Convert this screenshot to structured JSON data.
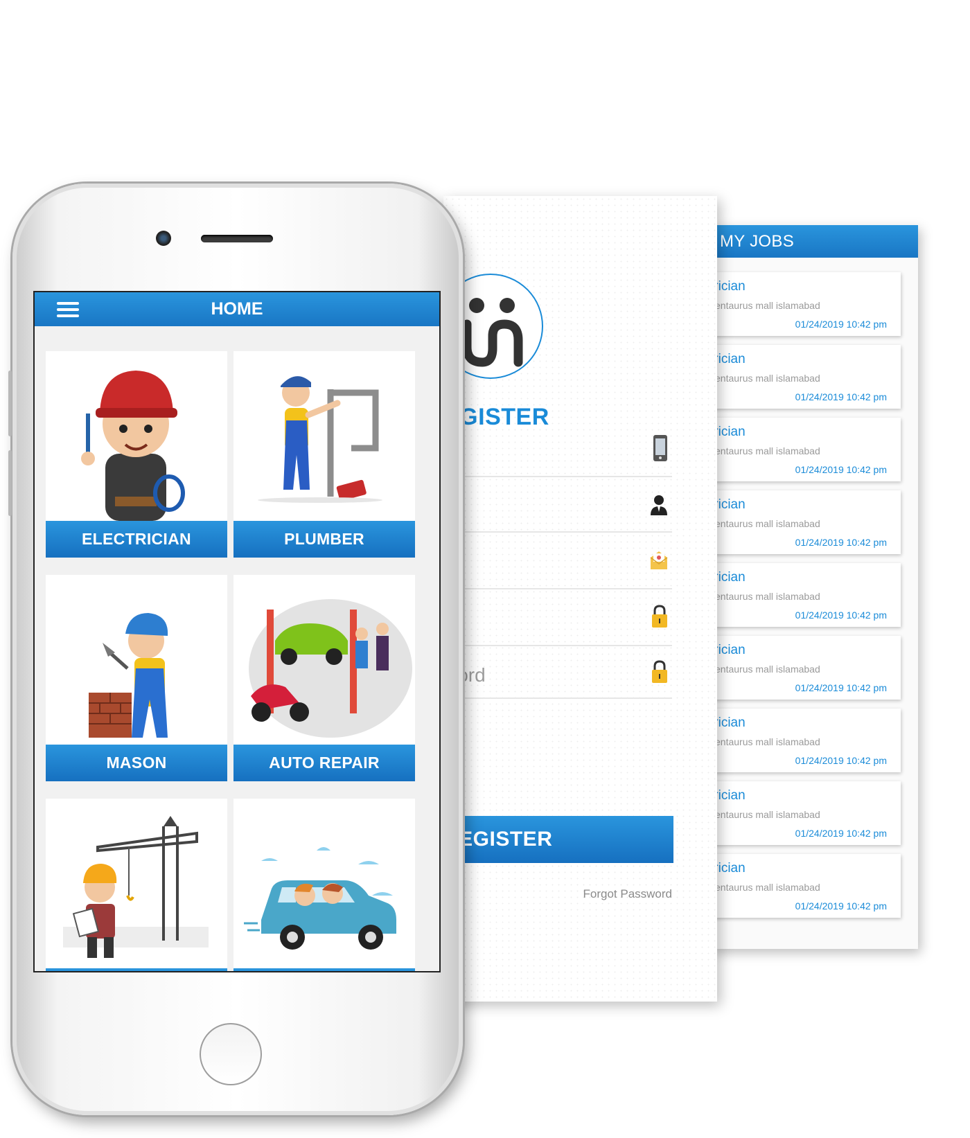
{
  "colors": {
    "accent": "#1a8bd8",
    "accent_dark": "#1670c0",
    "background": "#ffffff",
    "muted_text": "#9d9d9d"
  },
  "jobs_screen": {
    "header": "MY JOBS",
    "jobs": [
      {
        "title": "trician",
        "location": "centaurus mall islamabad",
        "datetime": "01/24/2019  10:42 pm"
      },
      {
        "title": "trician",
        "location": "centaurus mall islamabad",
        "datetime": "01/24/2019  10:42 pm"
      },
      {
        "title": "trician",
        "location": "centaurus mall islamabad",
        "datetime": "01/24/2019  10:42 pm"
      },
      {
        "title": "trician",
        "location": "centaurus mall islamabad",
        "datetime": "01/24/2019  10:42 pm"
      },
      {
        "title": "trician",
        "location": "centaurus mall islamabad",
        "datetime": "01/24/2019  10:42 pm"
      },
      {
        "title": "trician",
        "location": "centaurus mall islamabad",
        "datetime": "01/24/2019  10:42 pm"
      },
      {
        "title": "trician",
        "location": "centaurus mall islamabad",
        "datetime": "01/24/2019  10:42 pm"
      },
      {
        "title": "trician",
        "location": "centaurus mall islamabad",
        "datetime": "01/24/2019  10:42 pm"
      },
      {
        "title": "trician",
        "location": "centaurus mall islamabad",
        "datetime": "01/24/2019  10:42 pm"
      }
    ]
  },
  "register_screen": {
    "title": "EGISTER",
    "fields": [
      {
        "icon": "mobile-phone-icon",
        "text": ""
      },
      {
        "icon": "user-icon",
        "text": ""
      },
      {
        "icon": "email-icon",
        "text": ""
      },
      {
        "icon": "lock-icon",
        "text": ""
      },
      {
        "icon": "lock-icon",
        "text": "word"
      }
    ],
    "button_label": "REGISTER",
    "forgot_label": "Forgot Password"
  },
  "home_screen": {
    "title": "HOME",
    "menu_icon": "hamburger-menu-icon",
    "categories": [
      {
        "label": "ELECTRICIAN",
        "icon": "electrician-illustration"
      },
      {
        "label": "PLUMBER",
        "icon": "plumber-illustration"
      },
      {
        "label": "MASON",
        "icon": "mason-illustration"
      },
      {
        "label": "AUTO REPAIR",
        "icon": "auto-repair-illustration"
      },
      {
        "label": "",
        "icon": "construction-illustration"
      },
      {
        "label": "",
        "icon": "car-ride-illustration"
      }
    ]
  }
}
